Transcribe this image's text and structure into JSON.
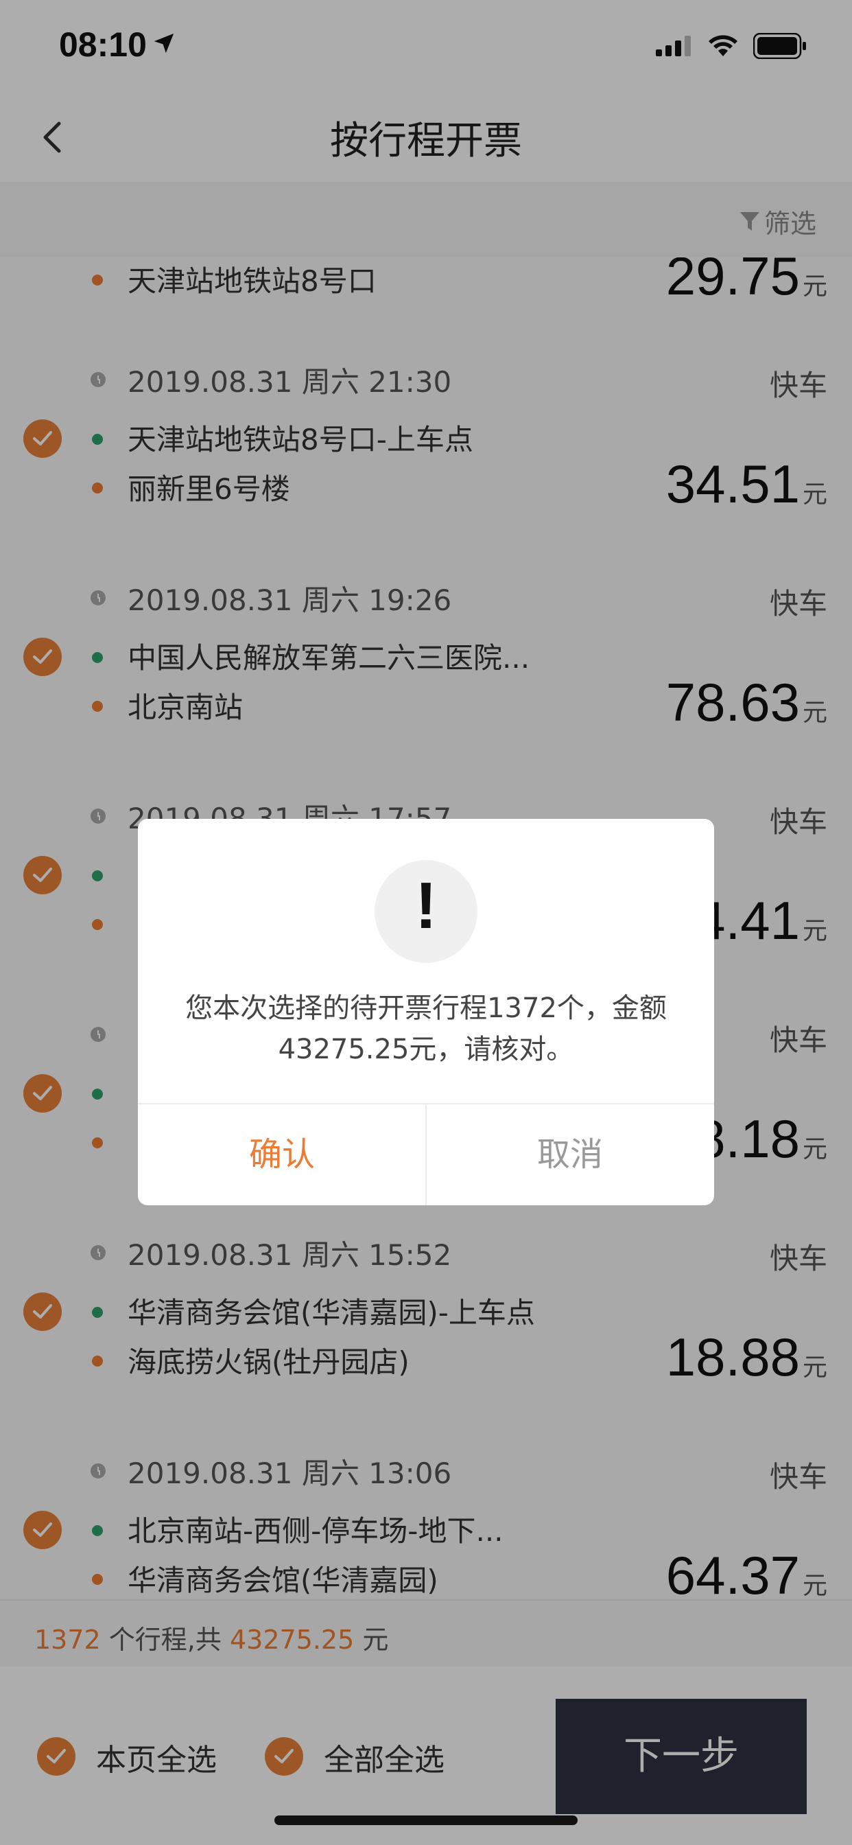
{
  "status": {
    "time": "08:10"
  },
  "nav": {
    "title": "按行程开票"
  },
  "filter": {
    "label": "筛选"
  },
  "trips": [
    {
      "end": "天津站地铁站8号口",
      "amount": "29.75",
      "unit": "元"
    },
    {
      "time": "2019.08.31 周六 21:30",
      "type": "快车",
      "start": "天津站地铁站8号口-上车点",
      "end": "丽新里6号楼",
      "amount": "34.51",
      "unit": "元"
    },
    {
      "time": "2019.08.31 周六 19:26",
      "type": "快车",
      "start": "中国人民解放军第二六三医院...",
      "end": "北京南站",
      "amount": "78.63",
      "unit": "元"
    },
    {
      "time": "2019.08.31 周六 17:57",
      "type": "快车",
      "start": "",
      "end": "",
      "amount": "4.41",
      "unit": "元"
    },
    {
      "time": "",
      "type": "快车",
      "start": "",
      "end": "",
      "amount": "8.18",
      "unit": "元"
    },
    {
      "time": "2019.08.31 周六 15:52",
      "type": "快车",
      "start": "华清商务会馆(华清嘉园)-上车点",
      "end": "海底捞火锅(牡丹园店)",
      "amount": "18.88",
      "unit": "元"
    },
    {
      "time": "2019.08.31 周六 13:06",
      "type": "快车",
      "start": "北京南站-西侧-停车场-地下...",
      "end": "华清商务会馆(华清嘉园)",
      "amount": "64.37",
      "unit": "元"
    }
  ],
  "summary": {
    "count": "1372",
    "count_suffix": " 个行程,共 ",
    "total": "43275.25",
    "unit": " 元"
  },
  "footer": {
    "select_page": "本页全选",
    "select_all": "全部全选",
    "next": "下一步"
  },
  "dialog": {
    "icon": "!",
    "message_line1": "您本次选择的待开票行程1372个，金额",
    "message_line2": "43275.25元，请核对。",
    "confirm": "确认",
    "cancel": "取消"
  },
  "colors": {
    "accent": "#ec7c33",
    "start_dot": "#2ea36b",
    "button_dark": "#2f3342"
  }
}
